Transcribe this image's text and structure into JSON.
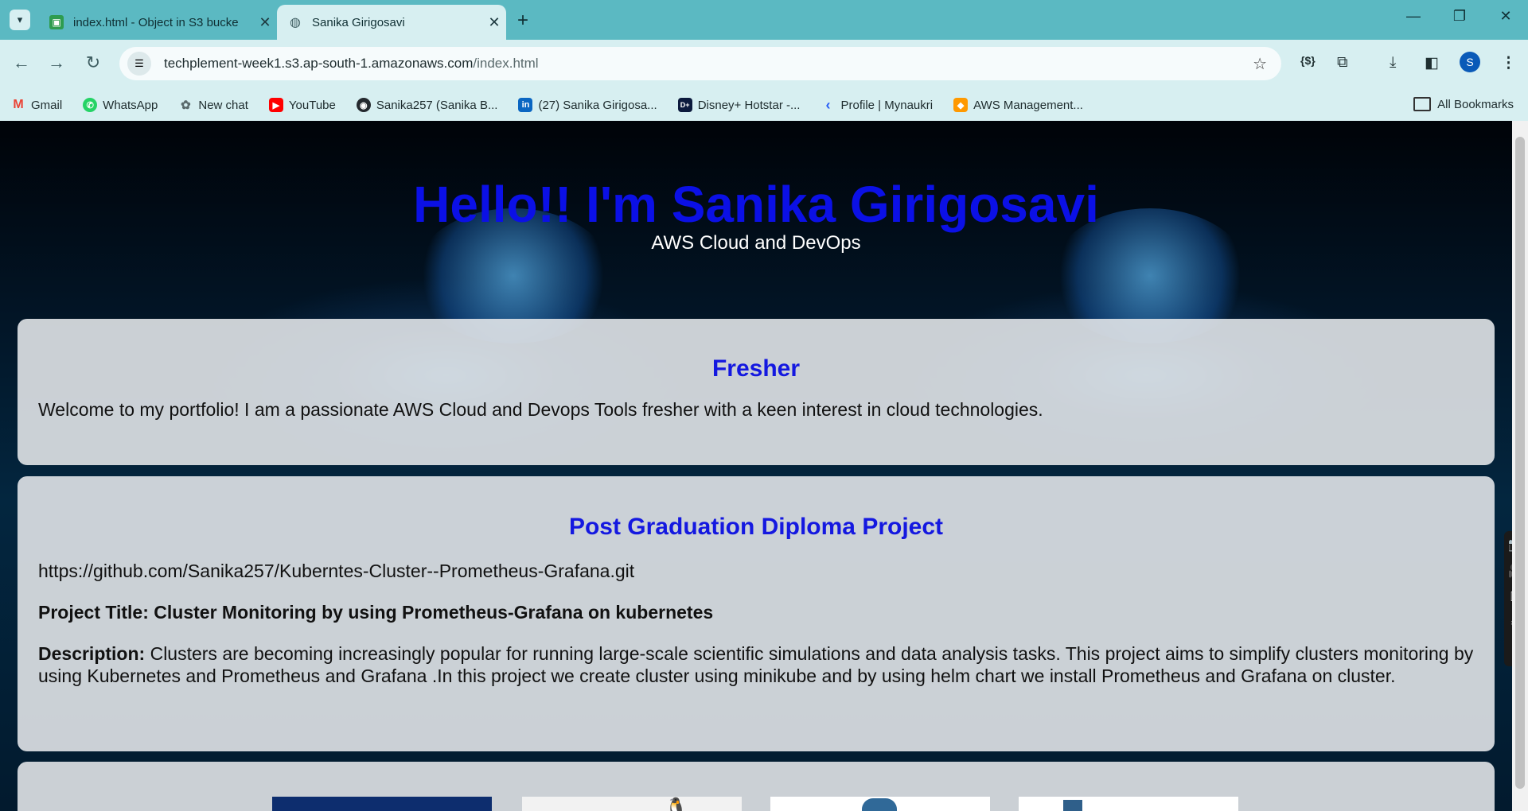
{
  "browser": {
    "tabs": [
      {
        "title": "index.html - Object in S3 bucke",
        "active": false
      },
      {
        "title": "Sanika Girigosavi",
        "active": true
      }
    ],
    "url_host": "techplement-week1.s3.ap-south-1.amazonaws.com",
    "url_path": "/index.html",
    "profile_initial": "S",
    "bookmarks": [
      {
        "label": "Gmail",
        "icon": "gmail-icon",
        "color": "#ea4335"
      },
      {
        "label": "WhatsApp",
        "icon": "whatsapp-icon",
        "color": "#25d366"
      },
      {
        "label": "New chat",
        "icon": "chatgpt-icon",
        "color": "#6b7b7d"
      },
      {
        "label": "YouTube",
        "icon": "youtube-icon",
        "color": "#ff0000"
      },
      {
        "label": "Sanika257 (Sanika B...",
        "icon": "github-icon",
        "color": "#24292e"
      },
      {
        "label": "(27) Sanika Girigosa...",
        "icon": "linkedin-icon",
        "color": "#0a66c2"
      },
      {
        "label": "Disney+ Hotstar -...",
        "icon": "hotstar-icon",
        "color": "#0c1a3d"
      },
      {
        "label": "Profile | Mynaukri",
        "icon": "naukri-icon",
        "color": "#275df5"
      },
      {
        "label": "AWS Management...",
        "icon": "aws-icon",
        "color": "#f90"
      }
    ],
    "all_bookmarks": "All Bookmarks"
  },
  "page": {
    "title": "Hello!! I'm Sanika Girigosavi",
    "subtitle": "AWS Cloud and DevOps",
    "fresher_heading": "Fresher",
    "fresher_text": "Welcome to my portfolio! I am a passionate AWS Cloud and Devops Tools fresher with a keen interest in cloud technologies.",
    "project_heading": "Post Graduation Diploma Project",
    "project_link": "https://github.com/Sanika257/Kuberntes-Cluster--Prometheus-Grafana.git",
    "project_title": "Project Title: Cluster Monitoring by using Prometheus-Grafana on kubernetes",
    "description_label": "Description:",
    "description_text": " Clusters are becoming increasingly popular for running large-scale scientific simulations and data analysis tasks. This project aims to simplify clusters monitoring by using Kubernetes and Prometheus and Grafana .In this project we create cluster using minikube and by using helm chart we install Prometheus and Grafana on cluster."
  },
  "colors": {
    "heading_blue": "#0b10e6",
    "tabbar": "#5bb9c2",
    "toolbar": "#d7eff1"
  }
}
